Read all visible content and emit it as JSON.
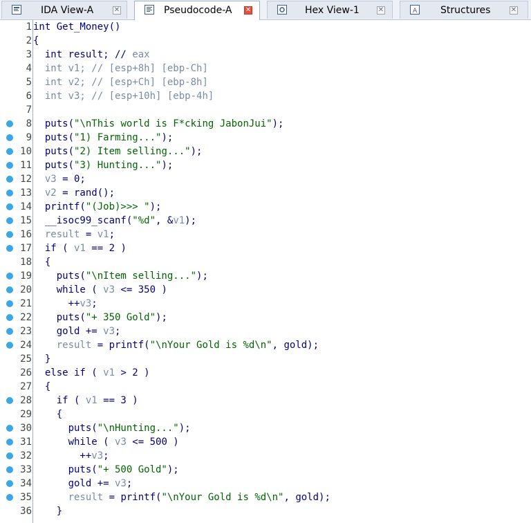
{
  "tabs": [
    {
      "label": "IDA View-A",
      "icon": "ida-view-icon",
      "active": false
    },
    {
      "label": "Pseudocode-A",
      "icon": "pseudocode-icon",
      "active": true
    },
    {
      "label": "Hex View-1",
      "icon": "hex-view-icon",
      "active": false
    },
    {
      "label": "Structures",
      "icon": "structures-icon",
      "active": false
    }
  ],
  "colors": {
    "keyword": "#000080",
    "variable": "#7a8ba8",
    "string": "#006400",
    "breakpoint": "#3aa7e6",
    "close_active": "#e64d3c"
  },
  "code_lines": [
    {
      "n": "1",
      "bp": false,
      "tokens": [
        [
          "k",
          "int Get_Money()"
        ]
      ]
    },
    {
      "n": "2",
      "bp": false,
      "tokens": [
        [
          "k",
          "{"
        ]
      ]
    },
    {
      "n": "3",
      "bp": false,
      "tokens": [
        [
          "k",
          "  int result; // "
        ],
        [
          "c",
          "eax"
        ]
      ]
    },
    {
      "n": "4",
      "bp": false,
      "tokens": [
        [
          "v",
          "  int v1; // "
        ],
        [
          "c",
          "[esp+8h] [ebp-Ch]"
        ]
      ]
    },
    {
      "n": "5",
      "bp": false,
      "tokens": [
        [
          "v",
          "  int v2; // "
        ],
        [
          "c",
          "[esp+Ch] [ebp-8h]"
        ]
      ]
    },
    {
      "n": "6",
      "bp": false,
      "tokens": [
        [
          "v",
          "  int v3; // "
        ],
        [
          "c",
          "[esp+10h] [ebp-4h]"
        ]
      ]
    },
    {
      "n": "7",
      "bp": false,
      "tokens": []
    },
    {
      "n": "8",
      "bp": true,
      "tokens": [
        [
          "k",
          "  puts("
        ],
        [
          "s",
          "\"\\nThis world is F*cking JabonJui\""
        ],
        [
          "k",
          ");"
        ]
      ]
    },
    {
      "n": "9",
      "bp": true,
      "tokens": [
        [
          "k",
          "  puts("
        ],
        [
          "s",
          "\"1) Farming...\""
        ],
        [
          "k",
          ");"
        ]
      ]
    },
    {
      "n": "10",
      "bp": true,
      "tokens": [
        [
          "k",
          "  puts("
        ],
        [
          "s",
          "\"2) Item selling...\""
        ],
        [
          "k",
          ");"
        ]
      ]
    },
    {
      "n": "11",
      "bp": true,
      "tokens": [
        [
          "k",
          "  puts("
        ],
        [
          "s",
          "\"3) Hunting...\""
        ],
        [
          "k",
          ");"
        ]
      ]
    },
    {
      "n": "12",
      "bp": true,
      "tokens": [
        [
          "v",
          "  v3"
        ],
        [
          "k",
          " = 0;"
        ]
      ]
    },
    {
      "n": "13",
      "bp": true,
      "tokens": [
        [
          "v",
          "  v2"
        ],
        [
          "k",
          " = rand();"
        ]
      ]
    },
    {
      "n": "14",
      "bp": true,
      "tokens": [
        [
          "k",
          "  printf("
        ],
        [
          "s",
          "\"(Job)>>> \""
        ],
        [
          "k",
          ");"
        ]
      ]
    },
    {
      "n": "15",
      "bp": true,
      "tokens": [
        [
          "k",
          "  __isoc99_scanf("
        ],
        [
          "s",
          "\"%d\""
        ],
        [
          "k",
          ", &"
        ],
        [
          "v",
          "v1"
        ],
        [
          "k",
          ");"
        ]
      ]
    },
    {
      "n": "16",
      "bp": true,
      "tokens": [
        [
          "v",
          "  result"
        ],
        [
          "k",
          " = "
        ],
        [
          "v",
          "v1"
        ],
        [
          "k",
          ";"
        ]
      ]
    },
    {
      "n": "17",
      "bp": true,
      "tokens": [
        [
          "k",
          "  if ( "
        ],
        [
          "v",
          "v1"
        ],
        [
          "k",
          " == 2 )"
        ]
      ]
    },
    {
      "n": "18",
      "bp": false,
      "tokens": [
        [
          "k",
          "  {"
        ]
      ]
    },
    {
      "n": "19",
      "bp": true,
      "tokens": [
        [
          "k",
          "    puts("
        ],
        [
          "s",
          "\"\\nItem selling...\""
        ],
        [
          "k",
          ");"
        ]
      ]
    },
    {
      "n": "20",
      "bp": true,
      "tokens": [
        [
          "k",
          "    while ( "
        ],
        [
          "v",
          "v3"
        ],
        [
          "k",
          " <= 350 )"
        ]
      ]
    },
    {
      "n": "21",
      "bp": true,
      "tokens": [
        [
          "k",
          "      ++"
        ],
        [
          "v",
          "v3"
        ],
        [
          "k",
          ";"
        ]
      ]
    },
    {
      "n": "22",
      "bp": true,
      "tokens": [
        [
          "k",
          "    puts("
        ],
        [
          "s",
          "\"+ 350 Gold\""
        ],
        [
          "k",
          ");"
        ]
      ]
    },
    {
      "n": "23",
      "bp": true,
      "tokens": [
        [
          "k",
          "    gold += "
        ],
        [
          "v",
          "v3"
        ],
        [
          "k",
          ";"
        ]
      ]
    },
    {
      "n": "24",
      "bp": true,
      "tokens": [
        [
          "v",
          "    result"
        ],
        [
          "k",
          " = printf("
        ],
        [
          "s",
          "\"\\nYour Gold is %d\\n\""
        ],
        [
          "k",
          ", gold);"
        ]
      ]
    },
    {
      "n": "25",
      "bp": false,
      "tokens": [
        [
          "k",
          "  }"
        ]
      ]
    },
    {
      "n": "26",
      "bp": false,
      "tokens": [
        [
          "k",
          "  else if ( "
        ],
        [
          "v",
          "v1"
        ],
        [
          "k",
          " > 2 )"
        ]
      ]
    },
    {
      "n": "27",
      "bp": false,
      "tokens": [
        [
          "k",
          "  {"
        ]
      ]
    },
    {
      "n": "28",
      "bp": true,
      "tokens": [
        [
          "k",
          "    if ( "
        ],
        [
          "v",
          "v1"
        ],
        [
          "k",
          " == 3 )"
        ]
      ]
    },
    {
      "n": "29",
      "bp": false,
      "tokens": [
        [
          "k",
          "    {"
        ]
      ]
    },
    {
      "n": "30",
      "bp": true,
      "tokens": [
        [
          "k",
          "      puts("
        ],
        [
          "s",
          "\"\\nHunting...\""
        ],
        [
          "k",
          ");"
        ]
      ]
    },
    {
      "n": "31",
      "bp": true,
      "tokens": [
        [
          "k",
          "      while ( "
        ],
        [
          "v",
          "v3"
        ],
        [
          "k",
          " <= 500 )"
        ]
      ]
    },
    {
      "n": "32",
      "bp": true,
      "tokens": [
        [
          "k",
          "        ++"
        ],
        [
          "v",
          "v3"
        ],
        [
          "k",
          ";"
        ]
      ]
    },
    {
      "n": "33",
      "bp": true,
      "tokens": [
        [
          "k",
          "      puts("
        ],
        [
          "s",
          "\"+ 500 Gold\""
        ],
        [
          "k",
          ");"
        ]
      ]
    },
    {
      "n": "34",
      "bp": true,
      "tokens": [
        [
          "k",
          "      gold += "
        ],
        [
          "v",
          "v3"
        ],
        [
          "k",
          ";"
        ]
      ]
    },
    {
      "n": "35",
      "bp": true,
      "tokens": [
        [
          "v",
          "      result"
        ],
        [
          "k",
          " = printf("
        ],
        [
          "s",
          "\"\\nYour Gold is %d\\n\""
        ],
        [
          "k",
          ", gold);"
        ]
      ]
    },
    {
      "n": "36",
      "bp": false,
      "tokens": [
        [
          "k",
          "    }"
        ]
      ]
    }
  ]
}
